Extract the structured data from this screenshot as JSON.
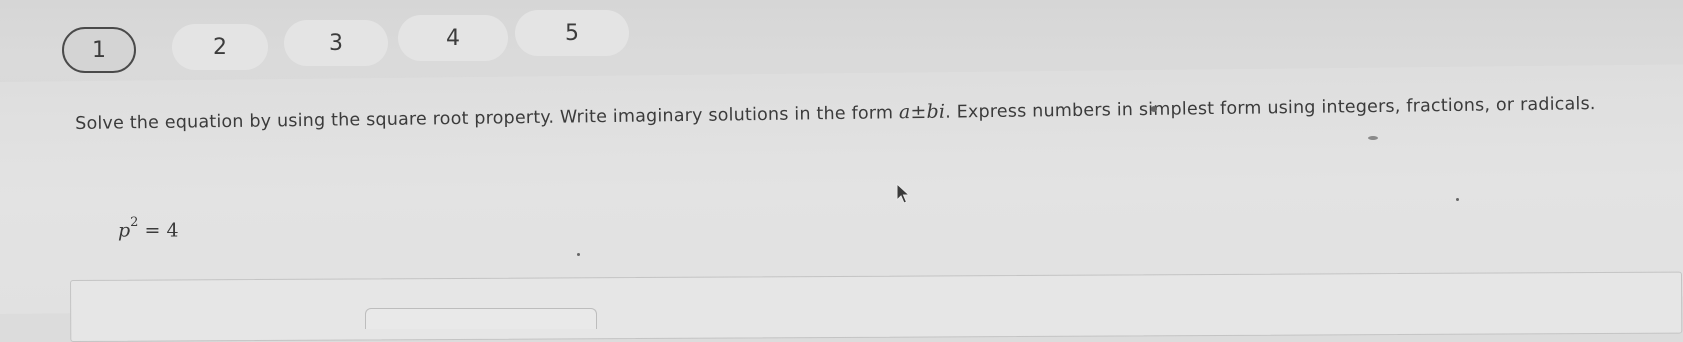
{
  "question_nav": {
    "items": [
      {
        "label": "1",
        "state": "current"
      },
      {
        "label": "2",
        "state": "unvisited"
      },
      {
        "label": "3",
        "state": "unvisited"
      },
      {
        "label": "4",
        "state": "unvisited"
      },
      {
        "label": "5",
        "state": "unvisited"
      }
    ]
  },
  "question": {
    "instructions_part1": "Solve the equation by using the square root property. Write imaginary solutions in the form ",
    "form_expression": "a±bi",
    "instructions_part2": ". Express numbers in simplest form using integers, fractions, or radicals.",
    "equation": {
      "variable": "p",
      "exponent": "2",
      "rhs": "= 4"
    }
  },
  "icons": {
    "cursor": "arrow-cursor-icon"
  },
  "colors": {
    "background": "#dcdcdc",
    "text": "#3b3b3b",
    "current_border": "#4a4a4a"
  }
}
